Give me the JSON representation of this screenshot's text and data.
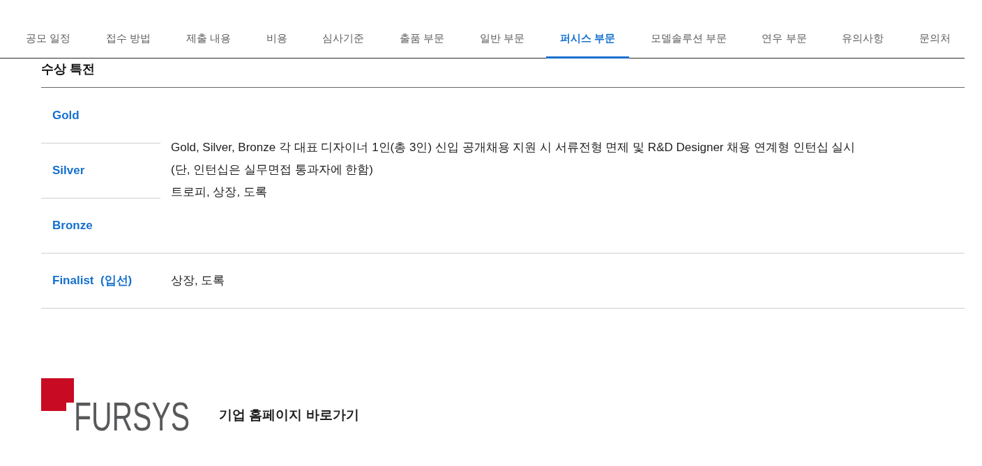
{
  "tabs": [
    {
      "label": "공모 일정",
      "selected": false
    },
    {
      "label": "접수 방법",
      "selected": false
    },
    {
      "label": "제출 내용",
      "selected": false
    },
    {
      "label": "비용",
      "selected": false
    },
    {
      "label": "심사기준",
      "selected": false
    },
    {
      "label": "출품 부문",
      "selected": false
    },
    {
      "label": "일반 부문",
      "selected": false
    },
    {
      "label": "퍼시스 부문",
      "selected": true
    },
    {
      "label": "모델솔루션 부문",
      "selected": false
    },
    {
      "label": "연우 부문",
      "selected": false
    },
    {
      "label": "유의사항",
      "selected": false
    },
    {
      "label": "문의처",
      "selected": false
    }
  ],
  "section": {
    "title": "수상 특전"
  },
  "award_groups": [
    {
      "labels": [
        "Gold",
        "Silver",
        "Bronze"
      ],
      "benefits": [
        "Gold, Silver, Bronze 각 대표 디자이너 1인(총 3인) 신입 공개채용 지원 시 서류전형 면제 및 R&D Designer 채용 연계형 인턴십 실시",
        "(단, 인턴십은 실무면접 통과자에 한함)",
        "트로피, 상장, 도록"
      ]
    },
    {
      "labels": [
        "Finalist  (입선)"
      ],
      "benefits": [
        "상장, 도록"
      ]
    }
  ],
  "footer": {
    "logo_wordmark": "FURSYS",
    "homepage_link": "기업 홈페이지 바로가기"
  }
}
